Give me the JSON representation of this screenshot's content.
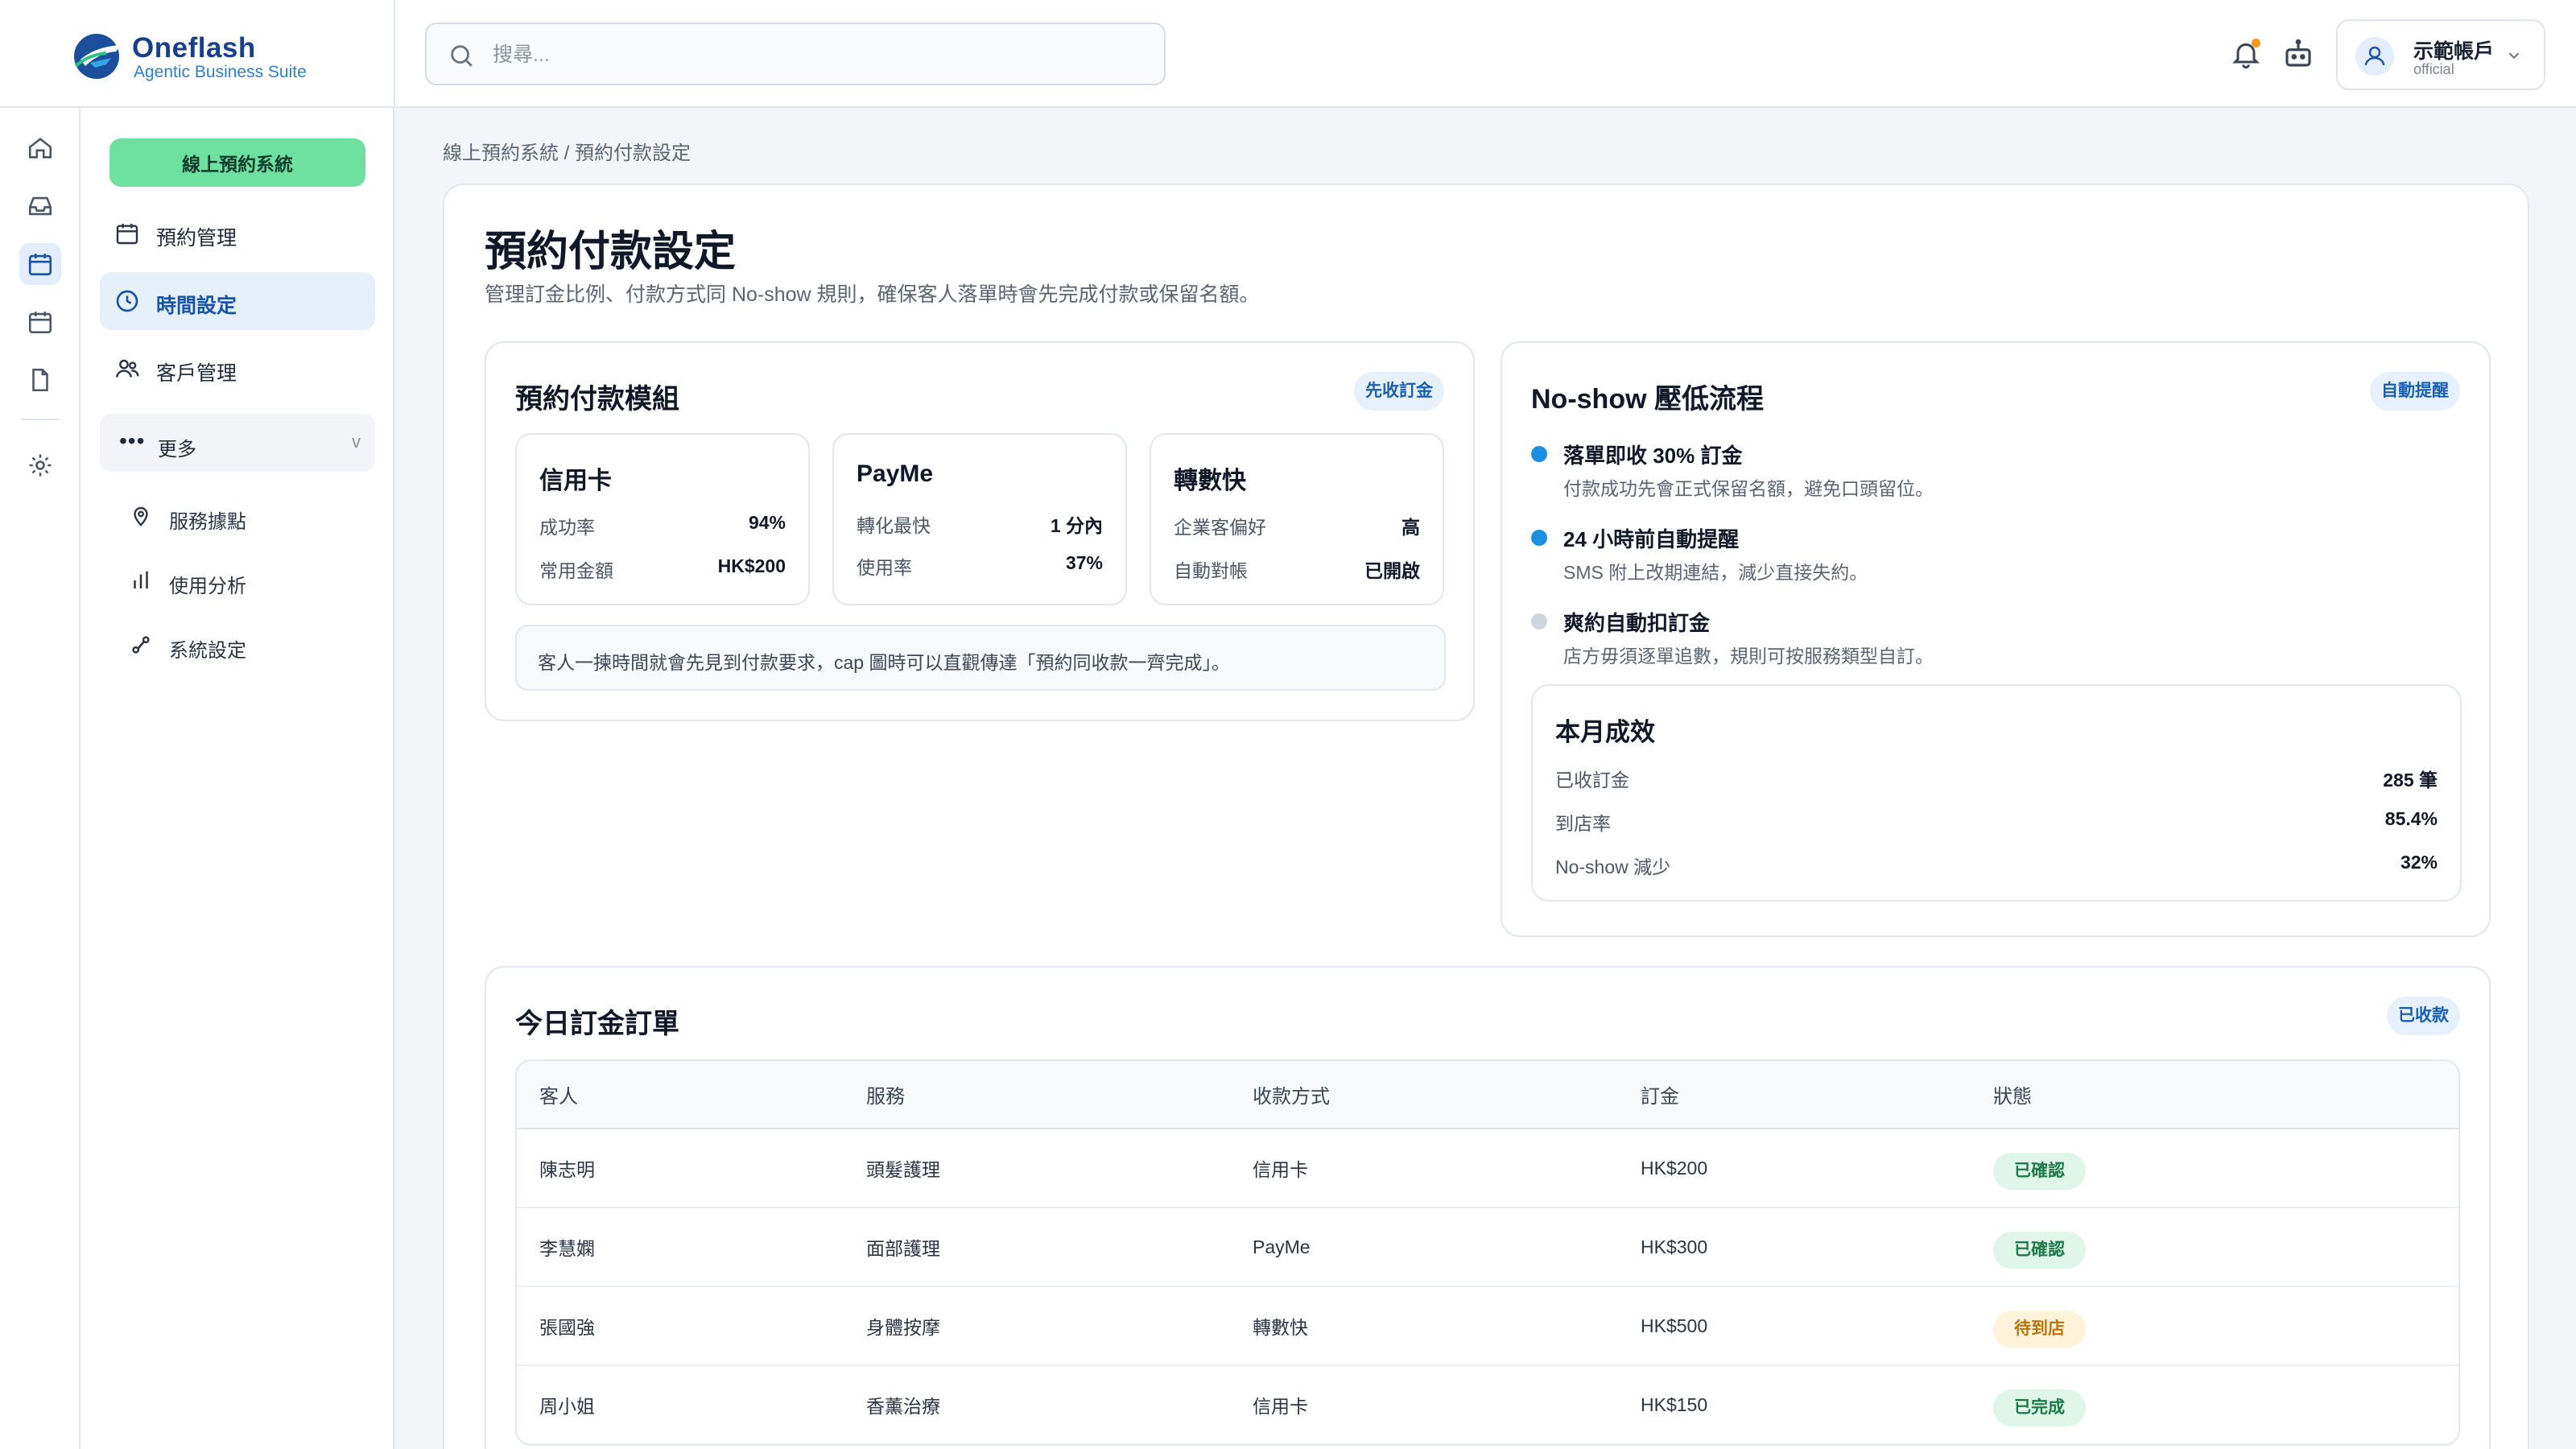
{
  "brand": {
    "name": "Oneflash",
    "subtitle": "Agentic Business Suite"
  },
  "search": {
    "placeholder": "搜尋..."
  },
  "account": {
    "name": "示範帳戶",
    "role": "official"
  },
  "sidebar": {
    "system_button": "線上預約系統",
    "items": [
      {
        "label": "預約管理",
        "icon": "calendar-icon"
      },
      {
        "label": "時間設定",
        "icon": "clock-icon",
        "active": true
      },
      {
        "label": "客戶管理",
        "icon": "users-icon"
      }
    ],
    "more": {
      "label": "更多",
      "chevron": "v"
    },
    "sub_items": [
      {
        "label": "服務據點",
        "icon": "map-pin-icon"
      },
      {
        "label": "使用分析",
        "icon": "bar-chart-icon"
      },
      {
        "label": "系統設定",
        "icon": "settings-flow-icon"
      }
    ]
  },
  "breadcrumb": {
    "text": "線上預約系統 / 預約付款設定"
  },
  "page": {
    "title": "預約付款設定",
    "description": "管理訂金比例、付款方式同 No-show 規則，確保客人落單時會先完成付款或保留名額。"
  },
  "payment_module": {
    "title": "預約付款模組",
    "badge": "先收訂金",
    "methods": [
      {
        "name": "信用卡",
        "rows": [
          {
            "label": "成功率",
            "value": "94%"
          },
          {
            "label": "常用金額",
            "value": "HK$200"
          }
        ]
      },
      {
        "name": "PayMe",
        "rows": [
          {
            "label": "轉化最快",
            "value": "1 分內"
          },
          {
            "label": "使用率",
            "value": "37%"
          }
        ]
      },
      {
        "name": "轉數快",
        "rows": [
          {
            "label": "企業客偏好",
            "value": "高"
          },
          {
            "label": "自動對帳",
            "value": "已開啟"
          }
        ]
      }
    ],
    "note": "客人一揀時間就會先見到付款要求，cap 圖時可以直觀傳達「預約同收款一齊完成」。"
  },
  "noshow": {
    "title": "No-show 壓低流程",
    "badge": "自動提醒",
    "steps": [
      {
        "title": "落單即收 30% 訂金",
        "desc": "付款成功先會正式保留名額，避免口頭留位。",
        "color": "#1d8fe0"
      },
      {
        "title": "24 小時前自動提醒",
        "desc": "SMS 附上改期連結，減少直接失約。",
        "color": "#1d8fe0"
      },
      {
        "title": "爽約自動扣訂金",
        "desc": "店方毋須逐單追數，規則可按服務類型自訂。",
        "color": "#cfd5de"
      }
    ],
    "month": {
      "title": "本月成效",
      "rows": [
        {
          "label": "已收訂金",
          "value": "285 筆"
        },
        {
          "label": "到店率",
          "value": "85.4%"
        },
        {
          "label": "No-show 減少",
          "value": "32%"
        }
      ]
    }
  },
  "orders": {
    "title": "今日訂金訂單",
    "badge": "已收款",
    "columns": [
      "客人",
      "服務",
      "收款方式",
      "訂金",
      "狀態"
    ],
    "rows": [
      {
        "customer": "陳志明",
        "service": "頭髮護理",
        "method": "信用卡",
        "deposit": "HK$200",
        "status": "已確認",
        "kind": "ok"
      },
      {
        "customer": "李慧嫻",
        "service": "面部護理",
        "method": "PayMe",
        "deposit": "HK$300",
        "status": "已確認",
        "kind": "ok"
      },
      {
        "customer": "張國強",
        "service": "身體按摩",
        "method": "轉數快",
        "deposit": "HK$500",
        "status": "待到店",
        "kind": "wait"
      },
      {
        "customer": "周小姐",
        "service": "香薰治療",
        "method": "信用卡",
        "deposit": "HK$150",
        "status": "已完成",
        "kind": "done"
      }
    ]
  },
  "colors": {
    "accent": "#1a54a6",
    "green": "#6ee0a0",
    "badge_bg": "#e6f1fb"
  }
}
